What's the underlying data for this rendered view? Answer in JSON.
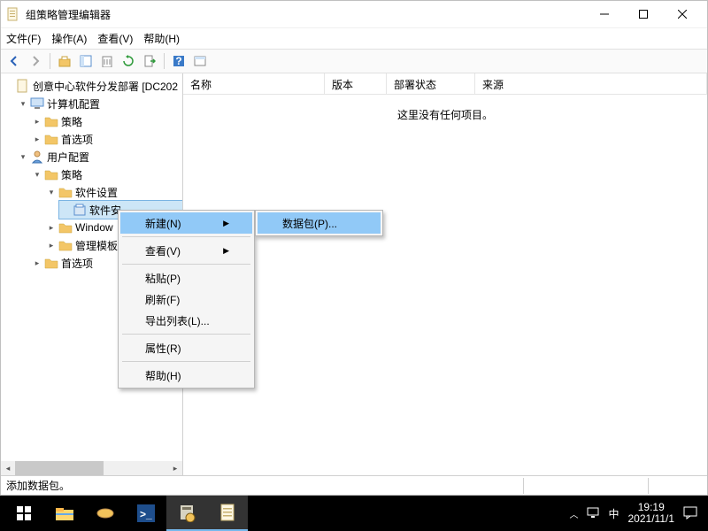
{
  "window": {
    "title": "组策略管理编辑器",
    "menu": {
      "file": "文件(F)",
      "action": "操作(A)",
      "view": "查看(V)",
      "help": "帮助(H)"
    }
  },
  "tree": {
    "root": "创意中心软件分发部署 [DC202",
    "computer_config": "计算机配置",
    "policies": "策略",
    "preferences": "首选项",
    "user_config": "用户配置",
    "software_settings": "软件设置",
    "software_install": "软件安",
    "windows_settings": "Window",
    "admin_templates": "管理模板"
  },
  "columns": {
    "name": "名称",
    "version": "版本",
    "deploy_state": "部署状态",
    "source": "来源"
  },
  "content": {
    "empty": "这里没有任何项目。"
  },
  "context": {
    "new": "新建(N)",
    "view": "查看(V)",
    "paste": "粘贴(P)",
    "refresh": "刷新(F)",
    "export": "导出列表(L)...",
    "properties": "属性(R)",
    "help": "帮助(H)",
    "package": "数据包(P)..."
  },
  "status": {
    "text": "添加数据包。"
  },
  "taskbar": {
    "ime": "中",
    "time": "19:19",
    "date": "2021/11/1"
  }
}
